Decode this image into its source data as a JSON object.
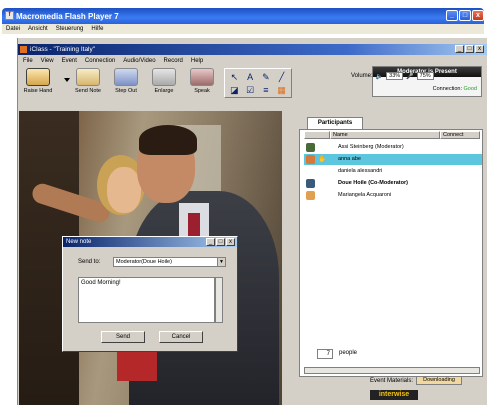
{
  "outer_window": {
    "title": "Macromedia Flash Player 7",
    "menu": [
      "Datei",
      "Ansicht",
      "Steuerung",
      "Hilfe"
    ]
  },
  "inner_window": {
    "title": "iClass - \"Training Italy\"",
    "menu": [
      "File",
      "View",
      "Event",
      "Connection",
      "Audio/Video",
      "Record",
      "Help"
    ]
  },
  "toolbar": {
    "tools": [
      "Raise Hand",
      "Send Note",
      "Step Out",
      "Enlarge",
      "Speak"
    ],
    "palette_icons": [
      "select-arrow-icon",
      "text-icon",
      "pen-icon",
      "line-icon",
      "eraser-icon",
      "check-icon",
      "lines-icon",
      "color-icon"
    ]
  },
  "status": {
    "moderator": "Moderator is Present",
    "connection_label": "Connection:",
    "connection_value": "Good",
    "volume_label": "Volume:",
    "volume_value": "33%",
    "mic_value": "75%"
  },
  "participants": {
    "tab_label": "Participants",
    "columns": [
      "",
      "Name",
      "Connect"
    ],
    "rows": [
      {
        "name": "Assi Steinberg (Moderator)",
        "selected": false,
        "bold": false,
        "hand": false
      },
      {
        "name": "anna abe",
        "selected": true,
        "bold": false,
        "hand": true
      },
      {
        "name": "daniela alessandri",
        "selected": false,
        "bold": false,
        "hand": false
      },
      {
        "name": "Doue Hoile (Co-Moderator)",
        "selected": false,
        "bold": true,
        "hand": false
      },
      {
        "name": "Mariangela Acquaroni",
        "selected": false,
        "bold": false,
        "hand": false
      }
    ],
    "count": "7",
    "count_label": "people"
  },
  "event_materials": {
    "label": "Event Materials:",
    "button": "Downloading"
  },
  "brand": "interwise",
  "note_dialog": {
    "title": "New note",
    "send_to_label": "Send to:",
    "send_to_value": "Moderator(Doue Hoile)",
    "message": "Good Morning!",
    "send_button": "Send",
    "cancel_button": "Cancel"
  },
  "colors": {
    "selected_row": "#5cc6df",
    "connection_good": "#2e9b2e",
    "brand_text": "#f6c20e"
  }
}
